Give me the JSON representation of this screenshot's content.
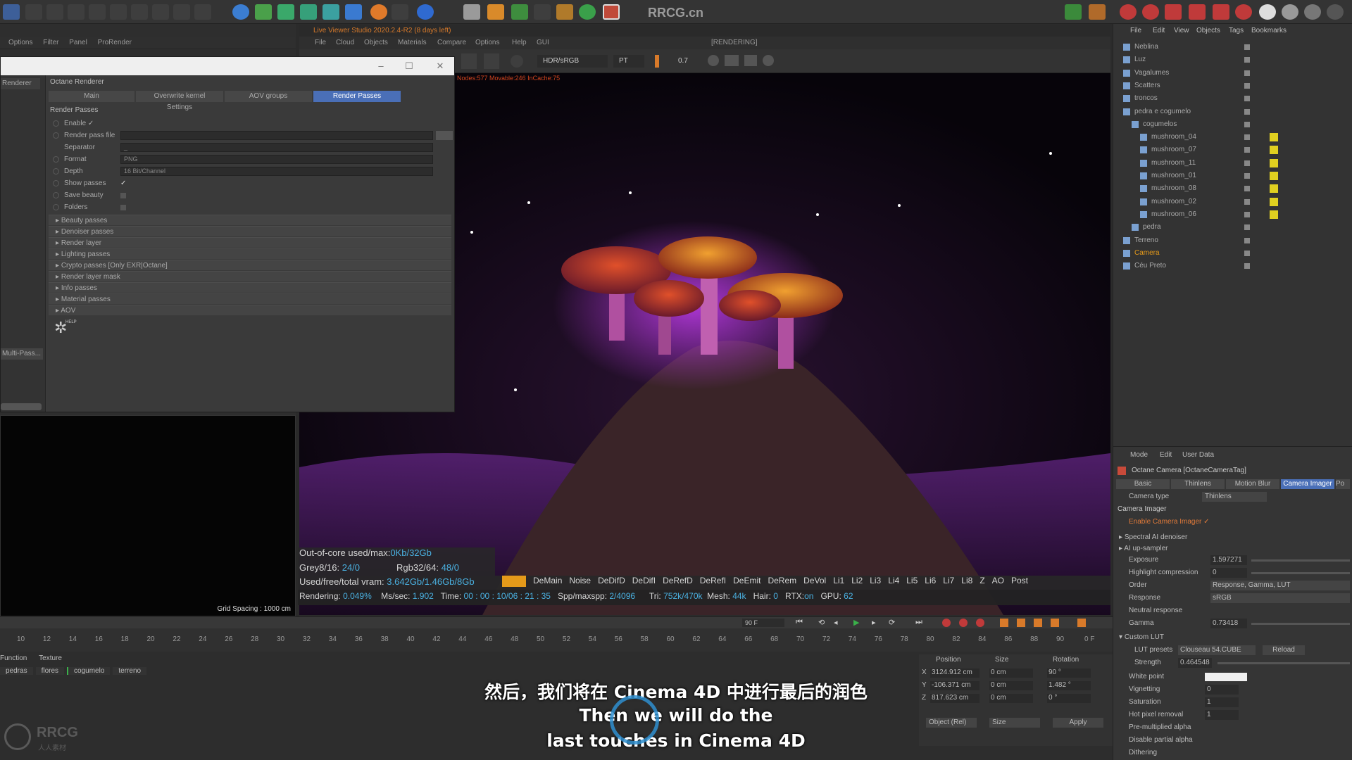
{
  "top_toolbar": {
    "watermark_title": "RRCG.cn"
  },
  "left_panel": {
    "menu": [
      "Options",
      "Filter",
      "Panel",
      "ProRender"
    ],
    "side_label": "Renderer",
    "multipass": "Multi-Pass..."
  },
  "viewer": {
    "title": "Live Viewer Studio 2020.2.4-R2 (8 days left)",
    "menu": [
      "File",
      "Cloud",
      "Objects",
      "Materials",
      "Compare",
      "Options",
      "Help",
      "GUI"
    ],
    "status": "[RENDERING]",
    "colorspace": "HDR/sRGB",
    "kernel": "PT",
    "value": "0.7",
    "node_info": "Nodes:577 Movable:246 InCache:75"
  },
  "render_settings": {
    "heading": "Octane Renderer",
    "tabs": [
      "Main",
      "Overwrite kernel Settings",
      "AOV groups",
      "Render Passes"
    ],
    "active_tab": "Render Passes",
    "section": "Render Passes",
    "enable": "Enable ✓",
    "pass_file": "Render pass file",
    "separator": "Separator",
    "separator_value": "_",
    "format_label": "Format",
    "format_value": "PNG",
    "depth_label": "Depth",
    "depth_value": "16 Bit/Channel",
    "show_passes": "Show passes",
    "save_beauty": "Save beauty",
    "folders": "Folders",
    "groups": [
      "Beauty passes",
      "Denoiser passes",
      "Render layer",
      "Lighting passes",
      "Crypto passes [Only EXR|Octane]",
      "Render layer mask",
      "Info passes",
      "Material passes",
      "AOV"
    ],
    "help": "HELP"
  },
  "small_view": {
    "grid": "Grid Spacing : 1000 cm"
  },
  "stats": {
    "out_of_core": "Out-of-core used/max:",
    "out_of_core_val": "0Kb/32Gb",
    "grey": "Grey8/16:",
    "grey_val": "24/0",
    "rgb": "Rgb32/64:",
    "rgb_val": "48/0",
    "vram": "Used/free/total vram:",
    "vram_val": "3.642Gb/1.46Gb/8Gb",
    "pass_tabs": [
      "Main",
      "DeMain",
      "Noise",
      "DeDifD",
      "DeDifI",
      "DeRefD",
      "DeRefI",
      "DeEmit",
      "DeRem",
      "DeVol",
      "Li1",
      "Li2",
      "Li3",
      "Li4",
      "Li5",
      "Li6",
      "Li7",
      "Li8",
      "Z",
      "AO",
      "Post"
    ],
    "rendering": "Rendering:",
    "rendering_val": "0.049%",
    "mssec": "Ms/sec:",
    "mssec_val": "1.902",
    "time": "Time:",
    "time_val": "00 : 00 : 10/06 : 21 : 35",
    "spp": "Spp/maxspp:",
    "spp_val": "2/4096",
    "tri": "Tri:",
    "tri_val": "752k/470k",
    "mesh": "Mesh:",
    "mesh_val": "44k",
    "hair": "Hair:",
    "hair_val": "0",
    "rtx": "RTX:",
    "rtx_val": "on",
    "gpu": "GPU:",
    "gpu_val": "62"
  },
  "object_manager": {
    "menu": [
      "File",
      "Edit",
      "View",
      "Objects",
      "Tags",
      "Bookmarks"
    ],
    "items": [
      {
        "name": "Neblina",
        "depth": 0
      },
      {
        "name": "Luz",
        "depth": 0
      },
      {
        "name": "Vagalumes",
        "depth": 0
      },
      {
        "name": "Scatters",
        "depth": 0
      },
      {
        "name": "troncos",
        "depth": 0
      },
      {
        "name": "pedra e cogumelo",
        "depth": 0
      },
      {
        "name": "cogumelos",
        "depth": 1
      },
      {
        "name": "mushroom_04",
        "depth": 2
      },
      {
        "name": "mushroom_07",
        "depth": 2
      },
      {
        "name": "mushroom_11",
        "depth": 2
      },
      {
        "name": "mushroom_01",
        "depth": 2
      },
      {
        "name": "mushroom_08",
        "depth": 2
      },
      {
        "name": "mushroom_02",
        "depth": 2
      },
      {
        "name": "mushroom_06",
        "depth": 2
      },
      {
        "name": "pedra",
        "depth": 1
      },
      {
        "name": "Terreno",
        "depth": 0
      },
      {
        "name": "Camera",
        "depth": 0
      },
      {
        "name": "Céu Preto",
        "depth": 0
      }
    ]
  },
  "attributes": {
    "menu": [
      "Mode",
      "Edit",
      "User Data"
    ],
    "title": "Octane Camera [OctaneCameraTag]",
    "tabs": [
      "Basic",
      "Thinlens",
      "Motion Blur",
      "Camera Imager",
      "Po"
    ],
    "camera_type_label": "Camera type",
    "camera_type": "Thinlens",
    "section": "Camera Imager",
    "enable": "Enable Camera Imager ✓",
    "spectral": "Spectral AI denoiser",
    "upsampler": "AI up-sampler",
    "exposure_label": "Exposure",
    "exposure": "1.597271",
    "highlight_label": "Highlight compression",
    "highlight": "0",
    "order_label": "Order",
    "order": "Response, Gamma, LUT",
    "response_label": "Response",
    "response": "sRGB",
    "neutral_label": "Neutral response",
    "gamma_label": "Gamma",
    "gamma": "0.73418",
    "custom_lut": "Custom LUT",
    "lut_presets_label": "LUT presets",
    "lut_presets": "Clouseau 54.CUBE",
    "reload": "Reload",
    "strength_label": "Strength",
    "strength": "0.464548",
    "white_point": "White point",
    "vignetting": "Vignetting",
    "vignetting_val": "0",
    "saturation": "Saturation",
    "saturation_val": "1",
    "hot_pixel": "Hot pixel removal",
    "hot_pixel_val": "1",
    "premult": "Pre-multiplied alpha",
    "disable_partial": "Disable partial alpha",
    "dithering": "Dithering"
  },
  "timeline": {
    "ticks": [
      "10",
      "12",
      "14",
      "16",
      "18",
      "20",
      "22",
      "24",
      "26",
      "28",
      "30",
      "32",
      "34",
      "36",
      "38",
      "40",
      "42",
      "44",
      "46",
      "48",
      "50",
      "52",
      "54",
      "56",
      "58",
      "60",
      "62",
      "64",
      "66",
      "68",
      "70",
      "72",
      "74",
      "76",
      "78",
      "80",
      "82",
      "84",
      "86",
      "88",
      "90"
    ],
    "frame_field": "90 F",
    "frame_end": "0 F"
  },
  "bottom_left": {
    "menu": [
      "Function",
      "Texture"
    ],
    "materials": [
      "pedras",
      "flores",
      "cogumelo",
      "terreno"
    ]
  },
  "coordinates": {
    "headers": [
      "Position",
      "Size",
      "Rotation"
    ],
    "x": "3124.912 cm",
    "y": "-106.371 cm",
    "z": "817.623 cm",
    "sx": "0 cm",
    "sy": "0 cm",
    "sz": "0 cm",
    "h": "90 °",
    "p": "1.482 °",
    "b": "0 °",
    "mode": "Object (Rel)",
    "size_mode": "Size",
    "apply": "Apply"
  },
  "subtitles": {
    "zh": "然后，我们将在 Cinema 4D 中进行最后的润色",
    "en1": "Then we will do the",
    "en2": "last touches in Cinema 4D"
  },
  "logo": {
    "text": "RRCG",
    "sub": "人人素材"
  }
}
